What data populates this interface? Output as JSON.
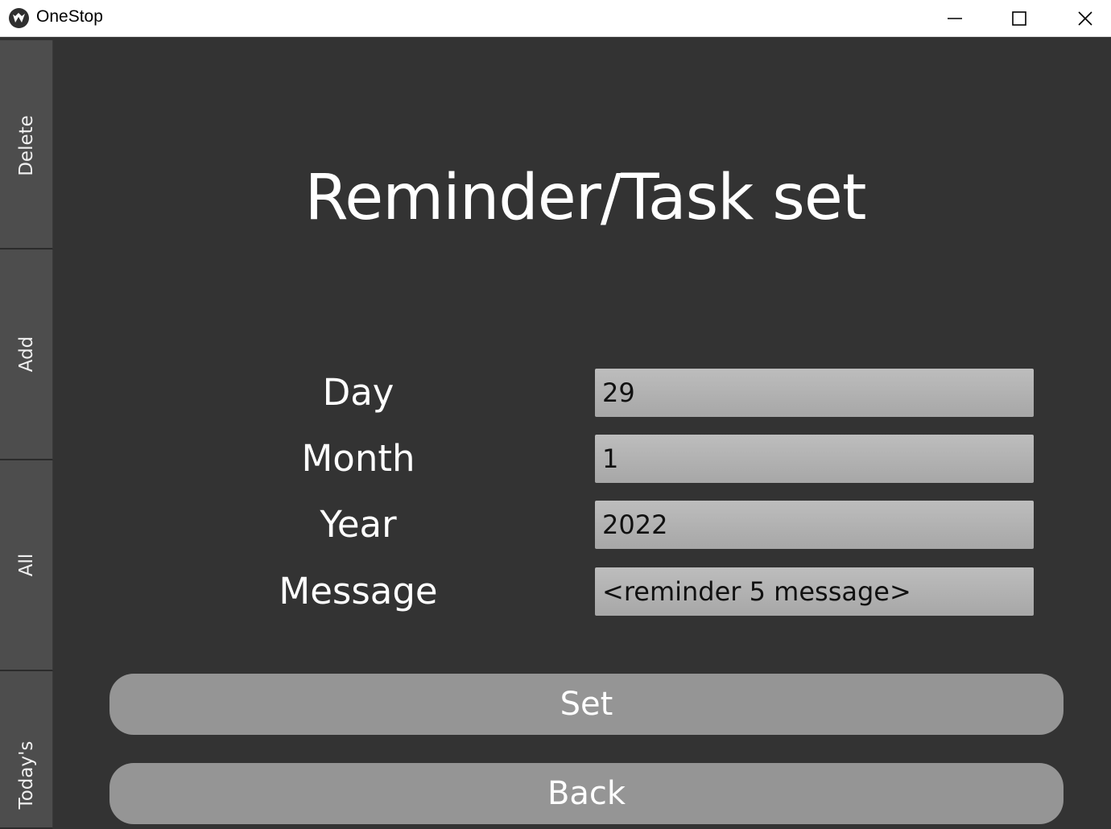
{
  "window": {
    "title": "OneStop",
    "icon": "kivy-logo-icon",
    "controls": [
      "minimize-icon",
      "maximize-icon",
      "close-icon"
    ]
  },
  "sidebar": {
    "tabs": [
      {
        "label": "Delete"
      },
      {
        "label": "Add"
      },
      {
        "label": "All"
      },
      {
        "label": "Today's"
      }
    ]
  },
  "main": {
    "title": "Reminder/Task set",
    "fields": [
      {
        "label": "Day",
        "value": "29"
      },
      {
        "label": "Month",
        "value": "1"
      },
      {
        "label": "Year",
        "value": "2022"
      },
      {
        "label": "Message",
        "value": "<reminder 5 message>"
      }
    ],
    "set_label": "Set",
    "back_label": "Back"
  },
  "colors": {
    "background": "#333333",
    "tab": "#4d4d4d",
    "input": "#b3b3b3",
    "button": "#959595",
    "text": "#ffffff"
  }
}
